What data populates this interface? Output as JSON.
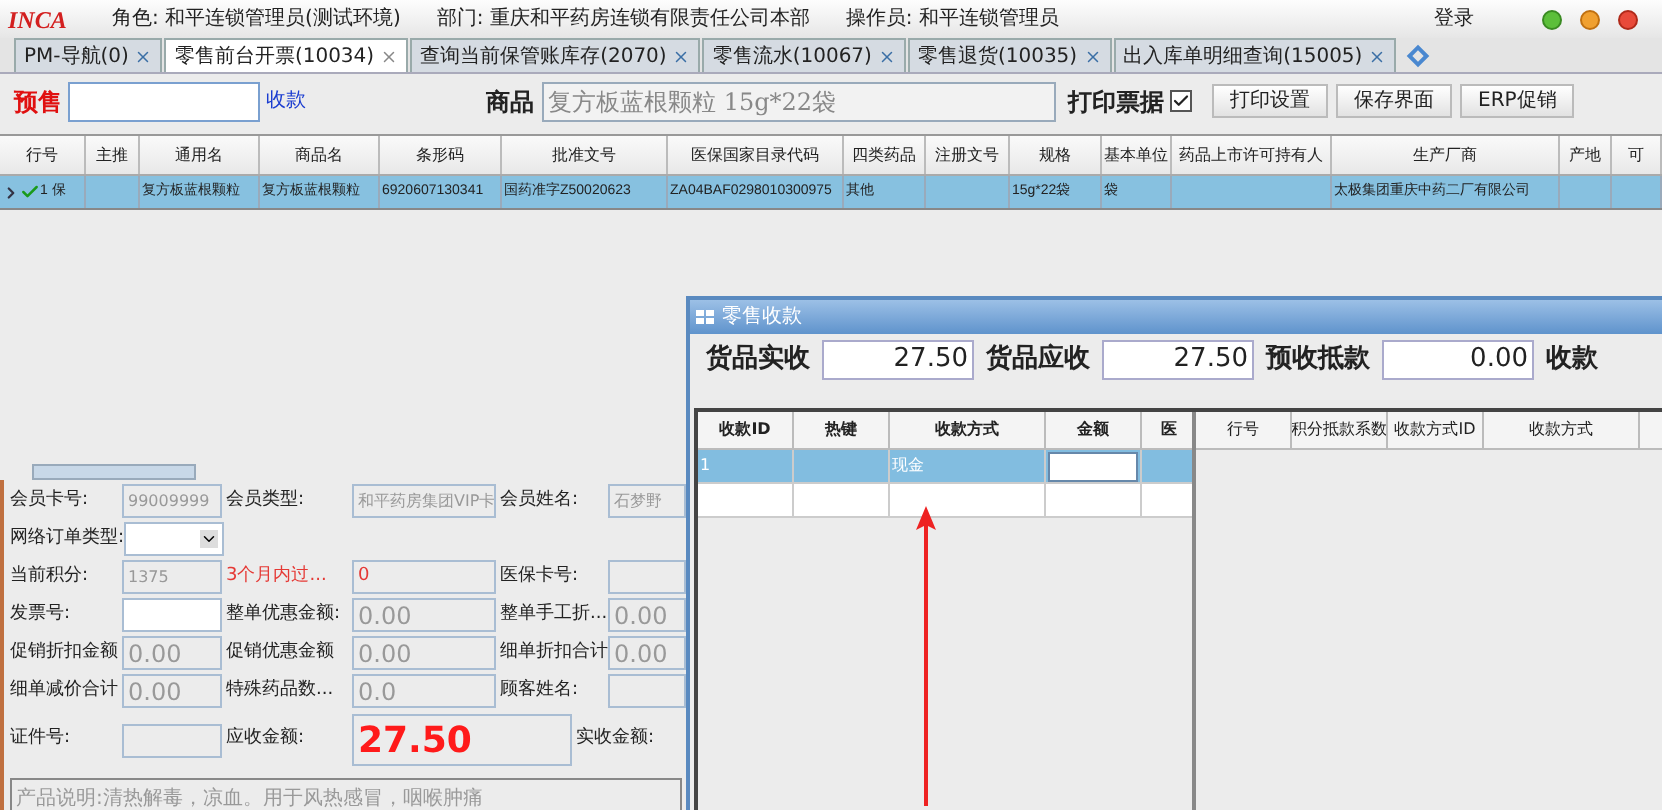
{
  "header": {
    "logo": "INCA",
    "role": "角色: 和平连锁管理员(测试环境)",
    "department": "部门: 重庆和平药房连锁有限责任公司本部",
    "operator": "操作员: 和平连锁管理员",
    "login": "登录"
  },
  "tabs": [
    {
      "label": "PM-导航(0)",
      "selected": false
    },
    {
      "label": "零售前台开票(10034)",
      "selected": true
    },
    {
      "label": "查询当前保管账库存(2070)",
      "selected": false
    },
    {
      "label": "零售流水(10067)",
      "selected": false
    },
    {
      "label": "零售退货(10035)",
      "selected": false
    },
    {
      "label": "出入库单明细查询(15005)",
      "selected": false
    }
  ],
  "toolbar": {
    "presale_label": "预售",
    "collect_link": "收款",
    "product_label": "商品",
    "product_value": "复方板蓝根颗粒 15g*22袋",
    "print_label": "打印票据",
    "print_checked": true,
    "buttons": [
      "打印设置",
      "保存界面",
      "ERP促销"
    ]
  },
  "table": {
    "columns": [
      "行号",
      "主推",
      "通用名",
      "商品名",
      "条形码",
      "批准文号",
      "医保国家目录代码",
      "四类药品",
      "注册文号",
      "规格",
      "基本单位",
      "药品上市许可持有人",
      "生产厂商",
      "产地",
      "可"
    ],
    "rows": [
      {
        "selected": true,
        "checked": true,
        "cells": [
          "1 保",
          "",
          "复方板蓝根颗粒",
          "复方板蓝根颗粒",
          "6920607130341",
          "国药准字Z50020623",
          "ZA04BAF0298010300975",
          "其他",
          "",
          "15g*22袋",
          "袋",
          "",
          "太极集团重庆中药二厂有限公司",
          "",
          ""
        ]
      }
    ]
  },
  "form": [
    [
      {
        "label": "会员卡号:",
        "value": "99009999",
        "editable": false
      },
      {
        "label": "会员类型:",
        "value": "和平药房集团VIP卡",
        "editable": false
      },
      {
        "label": "会员姓名:",
        "value": "石梦野",
        "editable": false
      }
    ],
    [
      {
        "label": "网络订单类型:",
        "editable": true,
        "kind": "dropdown"
      }
    ],
    [
      {
        "label": "当前积分:",
        "value": "1375",
        "editable": false
      },
      {
        "label": "3个月内过...",
        "value": "0",
        "editable": false,
        "alert": true
      },
      {
        "label": "医保卡号:",
        "editable": false
      }
    ],
    [
      {
        "label": "发票号:",
        "editable": true
      },
      {
        "label": "整单优惠金额:",
        "value": "0.00",
        "editable": false
      },
      {
        "label": "整单手工折...",
        "value": "0.00",
        "editable": false
      }
    ],
    [
      {
        "label": "促销折扣金额",
        "value": "0.00",
        "editable": false
      },
      {
        "label": "促销优惠金额",
        "value": "0.00",
        "editable": false
      },
      {
        "label": "细单折扣合计",
        "value": "0.00",
        "editable": false
      }
    ],
    [
      {
        "label": "细单减价合计",
        "value": "0.00",
        "editable": false
      },
      {
        "label": "特殊药品数...",
        "value": "0.0",
        "editable": false
      },
      {
        "label": "顾客姓名:",
        "editable": false
      }
    ],
    [
      {
        "label": "证件号:",
        "editable": false
      },
      {
        "label": "应收金额:",
        "value": "27.50",
        "editable": false,
        "kind": "total"
      },
      {
        "label": "实收金额:",
        "kind": "label_only"
      }
    ]
  ],
  "description": "产品说明:清热解毒，凉血。用于风热感冒，咽喉肿痛",
  "dialog": {
    "title": "零售收款",
    "fields": [
      {
        "label": "货品实收",
        "value": "27.50"
      },
      {
        "label": "货品应收",
        "value": "27.50"
      },
      {
        "label": "预收抵款",
        "value": "0.00"
      },
      {
        "label": "收款"
      }
    ],
    "payments": {
      "columns": [
        "收款ID",
        "热键",
        "收款方式",
        "金额",
        "医"
      ],
      "rows": [
        {
          "selected": true,
          "cells": [
            "1",
            "",
            "现金",
            "",
            ""
          ]
        },
        {
          "selected": false,
          "cells": [
            "",
            "",
            "",
            "",
            ""
          ]
        }
      ]
    },
    "points": {
      "columns": [
        "行号",
        "积分抵款系数",
        "收款方式ID",
        "收款方式"
      ]
    }
  }
}
